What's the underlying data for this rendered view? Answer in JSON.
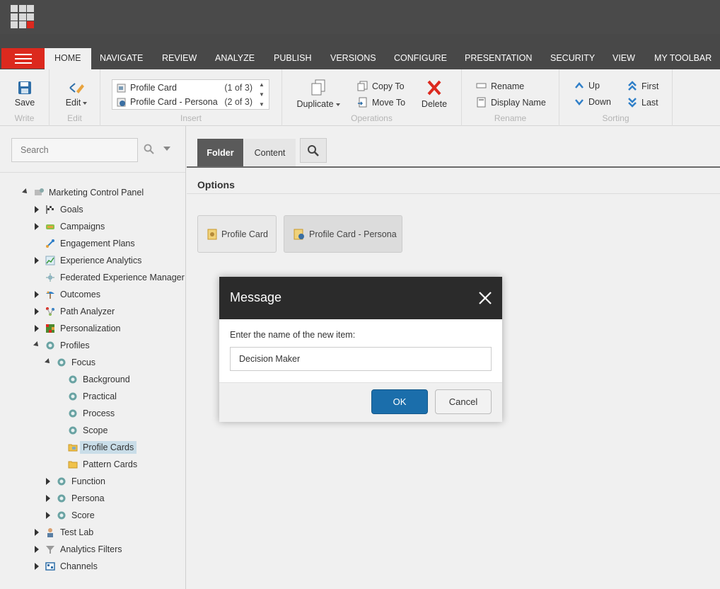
{
  "tabs": {
    "home": "HOME",
    "navigate": "NAVIGATE",
    "review": "REVIEW",
    "analyze": "ANALYZE",
    "publish": "PUBLISH",
    "versions": "VERSIONS",
    "configure": "CONFIGURE",
    "presentation": "PRESENTATION",
    "security": "SECURITY",
    "view": "VIEW",
    "my_toolbar": "MY TOOLBAR"
  },
  "ribbon": {
    "write": {
      "save": "Save",
      "label": "Write"
    },
    "edit": {
      "edit": "Edit",
      "label": "Edit"
    },
    "insert": {
      "items": [
        {
          "name": "Profile Card",
          "count": "(1 of 3)"
        },
        {
          "name": "Profile Card - Persona",
          "count": "(2 of 3)"
        }
      ],
      "label": "Insert"
    },
    "operations": {
      "duplicate": "Duplicate",
      "copy_to": "Copy To",
      "move_to": "Move To",
      "delete": "Delete",
      "label": "Operations"
    },
    "rename": {
      "rename": "Rename",
      "display_name": "Display Name",
      "label": "Rename"
    },
    "sorting": {
      "up": "Up",
      "down": "Down",
      "first": "First",
      "last": "Last",
      "label": "Sorting"
    }
  },
  "sidebar": {
    "search_placeholder": "Search",
    "tree": {
      "root": "Marketing Control Panel",
      "goals": "Goals",
      "campaigns": "Campaigns",
      "engagement_plans": "Engagement Plans",
      "experience_analytics": "Experience Analytics",
      "federated": "Federated Experience Manager",
      "outcomes": "Outcomes",
      "path_analyzer": "Path Analyzer",
      "personalization": "Personalization",
      "profiles": "Profiles",
      "focus": "Focus",
      "background": "Background",
      "practical": "Practical",
      "process": "Process",
      "scope": "Scope",
      "profile_cards": "Profile Cards",
      "pattern_cards": "Pattern Cards",
      "function": "Function",
      "persona": "Persona",
      "score": "Score",
      "test_lab": "Test Lab",
      "analytics_filters": "Analytics Filters",
      "channels": "Channels"
    }
  },
  "content": {
    "tab_folder": "Folder",
    "tab_content": "Content",
    "options_title": "Options",
    "option_profile_card": "Profile Card",
    "option_profile_card_persona": "Profile Card - Persona"
  },
  "modal": {
    "title": "Message",
    "label": "Enter the name of the new item:",
    "value": "Decision Maker",
    "ok": "OK",
    "cancel": "Cancel"
  }
}
